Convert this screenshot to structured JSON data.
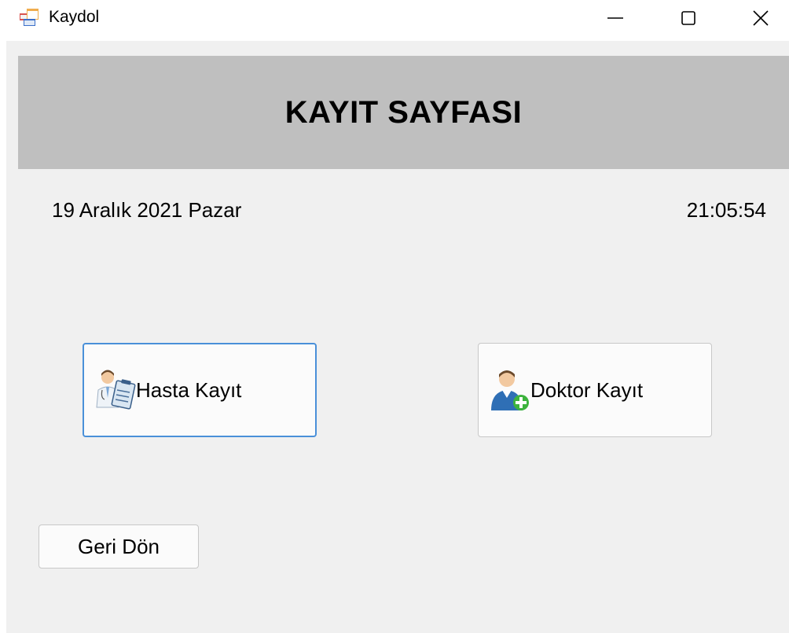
{
  "window": {
    "title": "Kaydol",
    "icon": "form-app-icon",
    "controls": [
      "minimize-icon",
      "maximize-icon",
      "close-icon"
    ]
  },
  "header": {
    "title": "KAYIT SAYFASI",
    "background": "#bfbfbf"
  },
  "status": {
    "date": "19 Aralık 2021 Pazar",
    "time": "21:05:54"
  },
  "buttons": {
    "hasta": {
      "label": "Hasta Kayıt",
      "icon": "doctor-clipboard-icon"
    },
    "doktor": {
      "label": "Doktor Kayıt",
      "icon": "add-user-icon"
    },
    "back": {
      "label": "Geri Dön"
    }
  },
  "colors": {
    "client_background": "#f0f0f0",
    "focus_border": "#4a90d9"
  }
}
